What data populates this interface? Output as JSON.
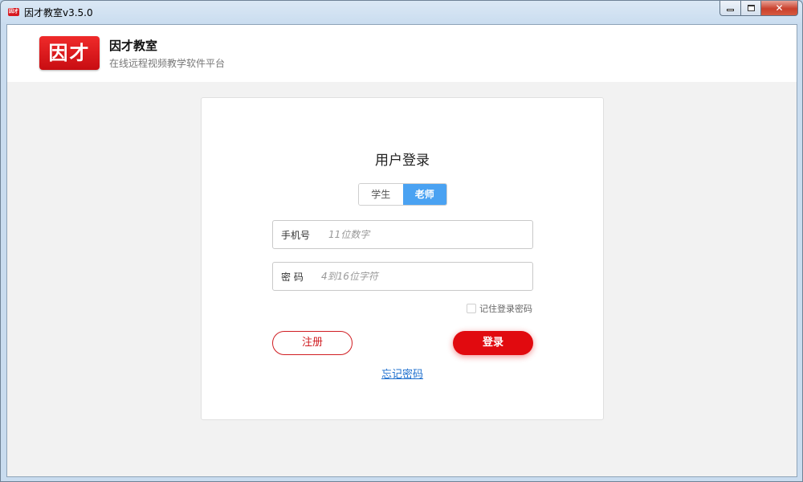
{
  "window": {
    "title": "因才教室v3.5.0",
    "icon_text": "因才",
    "controls": {
      "close_label": "✕"
    }
  },
  "header": {
    "logo_text": "因才",
    "brand_name": "因才教室",
    "tagline": "在线远程视频教学软件平台"
  },
  "login": {
    "title": "用户登录",
    "roles": [
      {
        "label": "学生",
        "active": false
      },
      {
        "label": "老师",
        "active": true
      }
    ],
    "phone": {
      "label": "手机号",
      "placeholder": "11位数字",
      "value": ""
    },
    "password": {
      "label": "密 码",
      "placeholder": "4到16位字符",
      "value": ""
    },
    "remember_label": "记住登录密码",
    "remember_checked": false,
    "register_label": "注册",
    "login_label": "登录",
    "forgot_label": "忘记密码"
  },
  "colors": {
    "brand_red": "#e10a0f",
    "active_tab": "#4aa2f2",
    "link": "#1e6fce"
  }
}
